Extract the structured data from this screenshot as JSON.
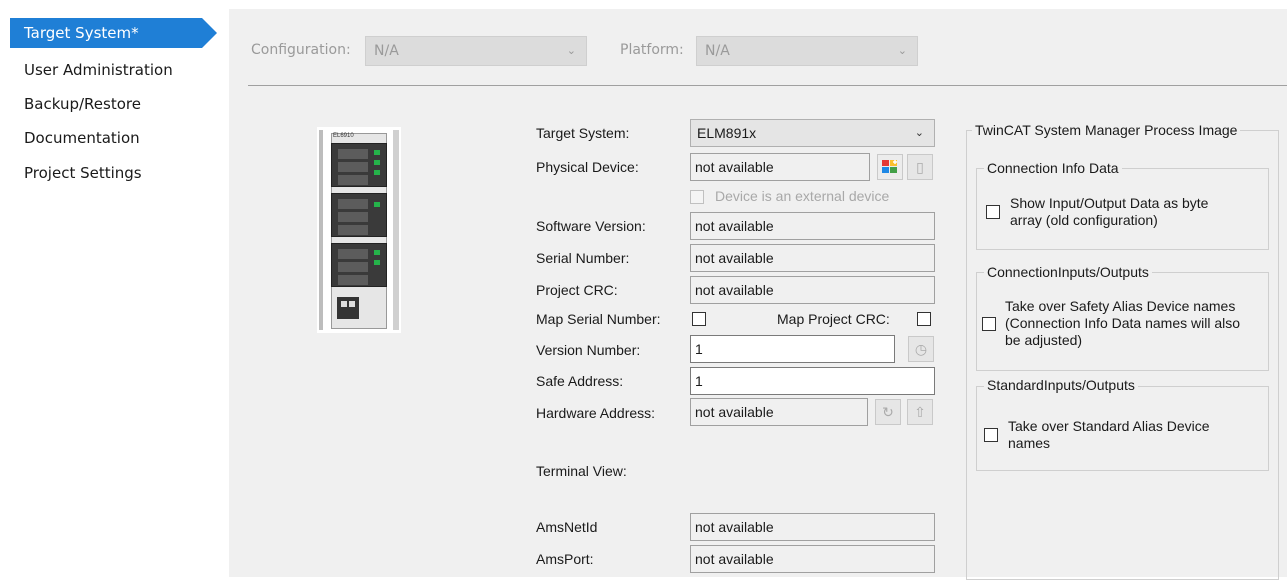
{
  "sidebar": {
    "items": [
      {
        "label": "Target System*",
        "active": true
      },
      {
        "label": "User Administration",
        "active": false
      },
      {
        "label": "Backup/Restore",
        "active": false
      },
      {
        "label": "Documentation",
        "active": false
      },
      {
        "label": "Project Settings",
        "active": false
      }
    ]
  },
  "topbar": {
    "configuration_label": "Configuration:",
    "configuration_value": "N/A",
    "platform_label": "Platform:",
    "platform_value": "N/A"
  },
  "form": {
    "target_system_label": "Target System:",
    "target_system_value": "ELM891x",
    "physical_device_label": "Physical Device:",
    "physical_device_value": "not available",
    "external_device_label": "Device is an external device",
    "software_version_label": "Software Version:",
    "software_version_value": "not available",
    "serial_number_label": "Serial Number:",
    "serial_number_value": "not available",
    "project_crc_label": "Project CRC:",
    "project_crc_value": "not available",
    "map_serial_label": "Map Serial Number:",
    "map_crc_label": "Map Project CRC:",
    "version_number_label": "Version Number:",
    "version_number_value": "1",
    "safe_address_label": "Safe Address:",
    "safe_address_value": "1",
    "hardware_address_label": "Hardware Address:",
    "hardware_address_value": "not available",
    "terminal_view_label": "Terminal View:",
    "amsnetid_label": "AmsNetId",
    "amsnetid_value": "not available",
    "amsport_label": "AmsPort:",
    "amsport_value": "not available"
  },
  "process_image": {
    "title": "TwinCAT System Manager Process Image",
    "groups": [
      {
        "title": "Connection Info Data",
        "option": "Show Input/Output Data as byte array (old configuration)",
        "line1": "Show Input/Output Data as byte",
        "line2": "array (old configuration)",
        "line3": ""
      },
      {
        "title": "ConnectionInputs/Outputs",
        "line1": "Take over Safety Alias Device names",
        "line2": "(Connection Info Data names will also",
        "line3": "be adjusted)"
      },
      {
        "title": "StandardInputs/Outputs",
        "line1": "Take over Standard Alias Device",
        "line2": "names",
        "line3": ""
      }
    ]
  },
  "terminal_image": {
    "label": "EL6910"
  },
  "colors": {
    "accent": "#1f7fd6",
    "panel": "#f0f0f0"
  }
}
